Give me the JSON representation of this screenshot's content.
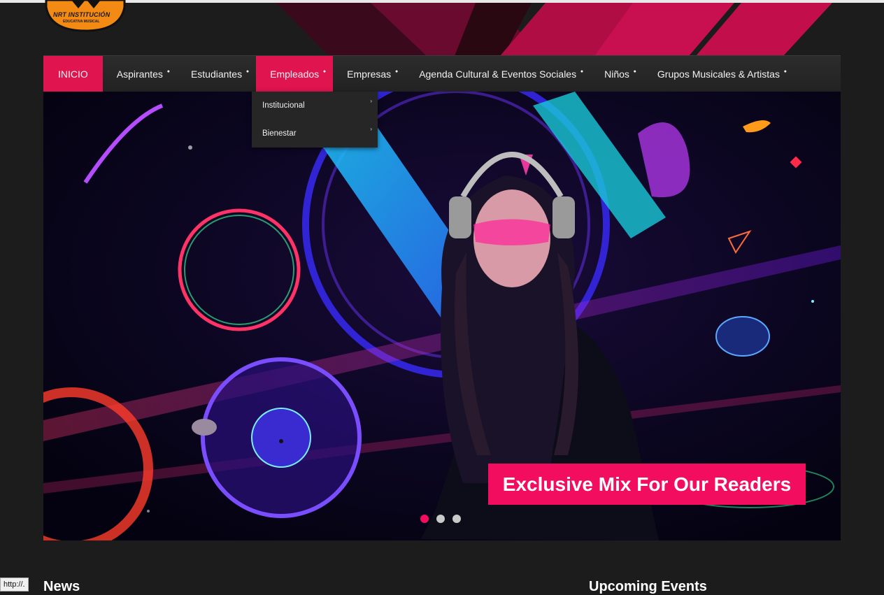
{
  "logo": {
    "title": "NRT INSTITUCIÓN",
    "subtitle": "EDUCATIVA MUSICAL"
  },
  "nav": {
    "items": [
      {
        "label": "INICIO"
      },
      {
        "label": "Aspirantes"
      },
      {
        "label": "Estudiantes"
      },
      {
        "label": "Empleados"
      },
      {
        "label": "Empresas"
      },
      {
        "label": "Agenda Cultural & Eventos Sociales"
      },
      {
        "label": "Niños"
      },
      {
        "label": "Grupos Musicales & Artistas"
      }
    ],
    "dropdown": [
      {
        "label": "Institucional"
      },
      {
        "label": "Bienestar"
      }
    ]
  },
  "hero": {
    "caption": "Exclusive Mix For Our Readers",
    "slides_total": 3,
    "active_slide": 1
  },
  "sections": {
    "news": "News",
    "events": "Upcoming Events"
  },
  "status_bar": {
    "url": "http://."
  },
  "colors": {
    "accent": "#e0144f",
    "caption_bg": "#f20d5e",
    "page_bg": "#1c1c1c"
  }
}
